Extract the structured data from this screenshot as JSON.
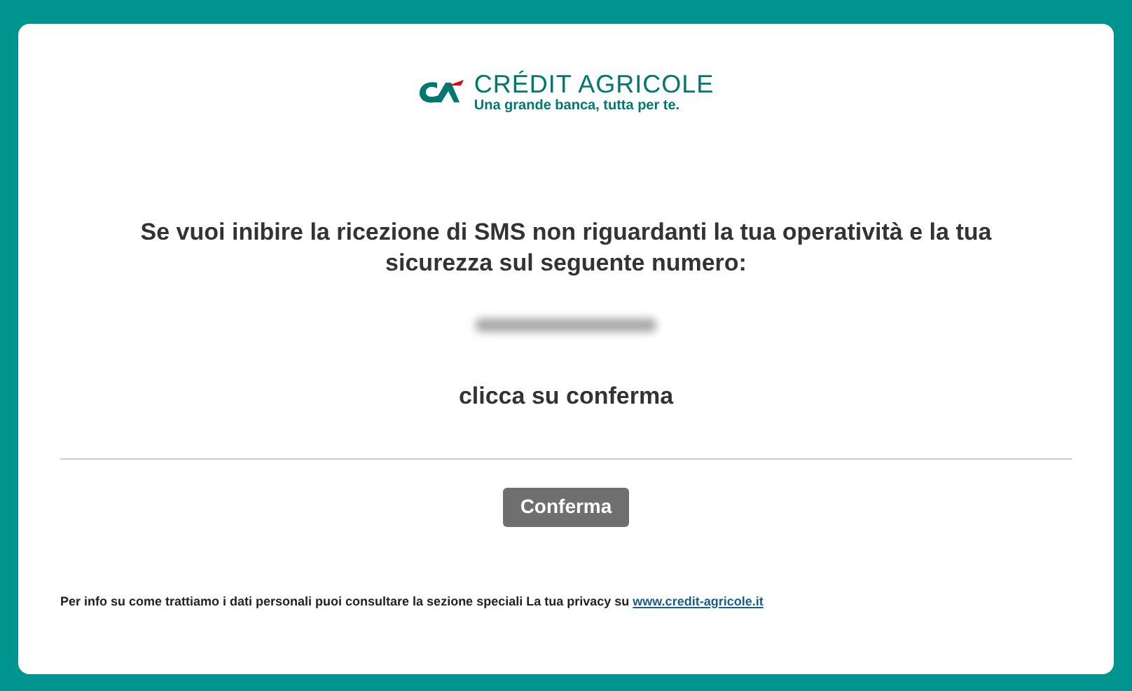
{
  "logo": {
    "name": "CRÉDIT AGRICOLE",
    "tagline": "Una grande banca, tutta per te."
  },
  "message": "Se vuoi inibire la ricezione di SMS non riguardanti la tua operatività e la tua sicurezza sul seguente numero:",
  "instruction": "clicca su conferma",
  "button": "Conferma",
  "footer": {
    "text": "Per info su come trattiamo i dati personali puoi consultare la sezione speciali La tua privacy su",
    "link": "www.credit-agricole.it"
  }
}
